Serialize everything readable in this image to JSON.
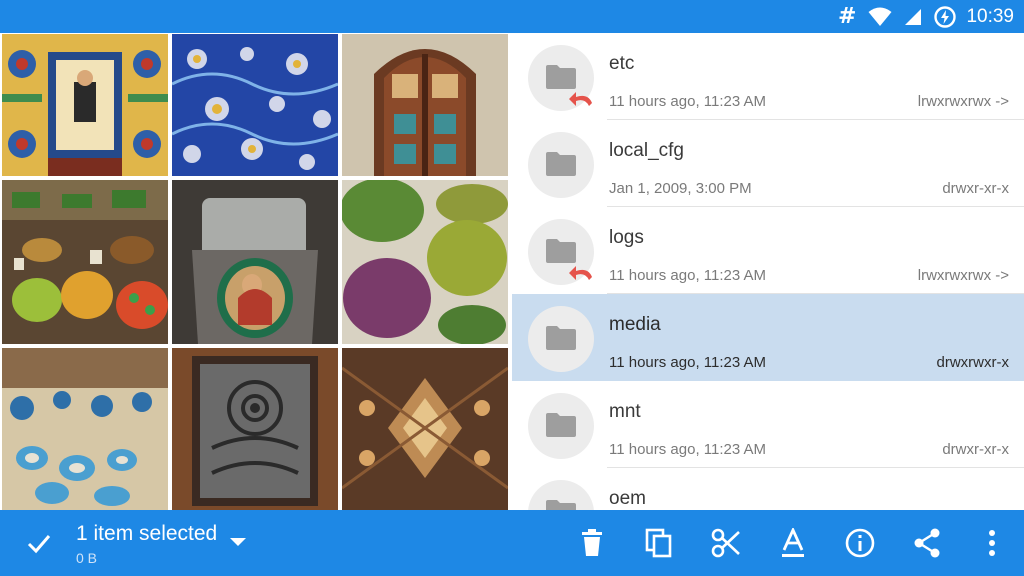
{
  "status_bar": {
    "time": "10:39",
    "hash_symbol": "#",
    "icons": [
      "hash-icon",
      "wifi-icon",
      "signal-icon",
      "battery-charging-icon"
    ]
  },
  "gallery": {
    "tiles": [
      {
        "name": "tile-tiled-portrait",
        "subject": "tiled wall portrait"
      },
      {
        "name": "tile-blue-tiles",
        "subject": "blue patterned tiles"
      },
      {
        "name": "tile-wooden-door",
        "subject": "arched wooden door"
      },
      {
        "name": "tile-spice-market",
        "subject": "spice market stall"
      },
      {
        "name": "tile-painted-bottle",
        "subject": "painted glass bottle"
      },
      {
        "name": "tile-herb-sacks",
        "subject": "herb sacks"
      },
      {
        "name": "tile-pottery-stall",
        "subject": "pottery stall"
      },
      {
        "name": "tile-ornate-door",
        "subject": "ornate metal door"
      },
      {
        "name": "tile-mirror-ceiling",
        "subject": "mirrored mosaic ceiling"
      }
    ]
  },
  "files": [
    {
      "name": "etc",
      "date": "11 hours ago, 11:23 AM",
      "perm": "lrwxrwxrwx ->",
      "symlink": true,
      "selected": false
    },
    {
      "name": "local_cfg",
      "date": "Jan 1, 2009, 3:00 PM",
      "perm": "drwxr-xr-x",
      "symlink": false,
      "selected": false
    },
    {
      "name": "logs",
      "date": "11 hours ago, 11:23 AM",
      "perm": "lrwxrwxrwx ->",
      "symlink": true,
      "selected": false
    },
    {
      "name": "media",
      "date": "11 hours ago, 11:23 AM",
      "perm": "drwxrwxr-x",
      "symlink": false,
      "selected": true
    },
    {
      "name": "mnt",
      "date": "11 hours ago, 11:23 AM",
      "perm": "drwxr-xr-x",
      "symlink": false,
      "selected": false
    },
    {
      "name": "oem",
      "date": "",
      "perm": "",
      "symlink": false,
      "selected": false
    }
  ],
  "action_bar": {
    "selection_title": "1 item selected",
    "selection_size": "0 B",
    "actions": [
      "done-icon",
      "delete-icon",
      "copy-icon",
      "cut-icon",
      "rename-icon",
      "info-icon",
      "share-icon",
      "more-icon"
    ]
  },
  "colors": {
    "accent": "#1e88e5",
    "selected_row": "#c9dcef",
    "symlink_badge": "#e5534b"
  }
}
